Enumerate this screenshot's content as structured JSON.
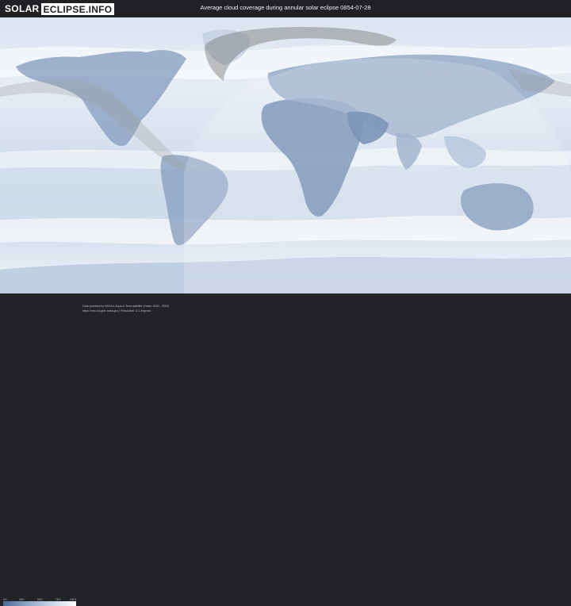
{
  "header": {
    "logo_part1": "SOLAR",
    "logo_part2": "ECLIPSE.INFO",
    "title": "Average cloud coverage during annular solar eclipse 0854-07-28"
  },
  "map": {
    "subject": "world cloud coverage",
    "projection": "equirectangular",
    "colors": {
      "clear_land": "#4e6c98",
      "partly_cloudy": "#9fb6d2",
      "cloudy": "#dfe7f1",
      "overcast": "#ffffff",
      "eclipse_shadow": "#909090",
      "visibility_highlight": "#ffffff"
    }
  },
  "legend": {
    "ticks": [
      "0%",
      "25%",
      "50%",
      "75%",
      "100%"
    ]
  },
  "footer": {
    "credit_line1": "Data provided by NASA's Aqua & Terra satellite (Years: 2000 - 2019)",
    "credit_line2": "https://neo.sci.gsfc.nasa.gov | Resolution: 0.1 degrees"
  }
}
